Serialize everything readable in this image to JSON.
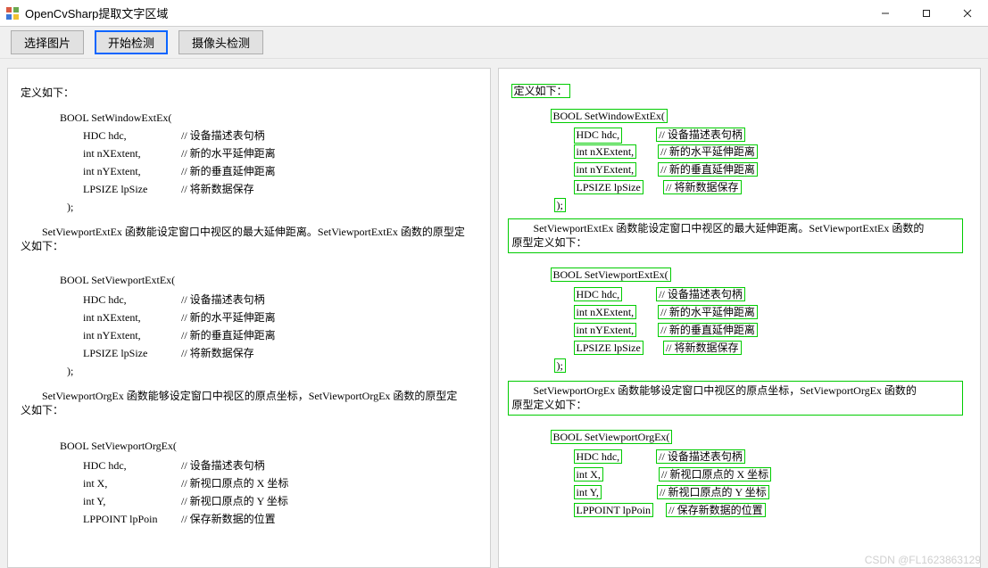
{
  "window": {
    "title": "OpenCvSharp提取文字区域"
  },
  "toolbar": {
    "btn_select": "选择图片",
    "btn_detect": "开始检测",
    "btn_camera": "摄像头检测"
  },
  "doc": {
    "def_label": "定义如下：",
    "fn1_sig": "BOOL SetWindowExtEx(",
    "fn_close": ");",
    "p_hdc": "HDC hdc,",
    "c_hdc": "// 设备描述表句柄",
    "p_nx": "int nXExtent,",
    "c_nx": "// 新的水平延伸距离",
    "p_ny": "int nYExtent,",
    "c_ny": "// 新的垂直延伸距离",
    "p_lpsize": "LPSIZE lpSize",
    "c_lpsize": "// 将新数据保存",
    "para_vpext": "SetViewportExtEx 函数能设定窗口中视区的最大延伸距离。SetViewportExtEx 函数的原型定义如下：",
    "fn2_sig": "BOOL SetViewportExtEx(",
    "para_vporg": "SetViewportOrgEx 函数能够设定窗口中视区的原点坐标，SetViewportOrgEx 函数的原型定义如下：",
    "fn3_sig": "BOOL SetViewportOrgEx(",
    "p_intx": "int X,",
    "c_intx": "// 新视口原点的 X 坐标",
    "p_inty": "int Y,",
    "c_inty": "// 新视口原点的 Y 坐标",
    "p_lppoint": "LPPOINT lpPoin",
    "c_lppoint": "// 保存新数据的位置"
  },
  "right_para_vpext": {
    "seg1": "SetViewportExtEx 函数能设定窗口中视区的最大延伸距离。SetViewportExtEx 函数的",
    "seg2": "原型定义如下："
  },
  "right_para_vporg": {
    "seg1": "SetViewportOrgEx 函数能够设定窗口中视区的原点坐标，SetViewportOrgEx 函数的",
    "seg2": "原型定义如下："
  },
  "watermark": "CSDN @FL1623863129"
}
